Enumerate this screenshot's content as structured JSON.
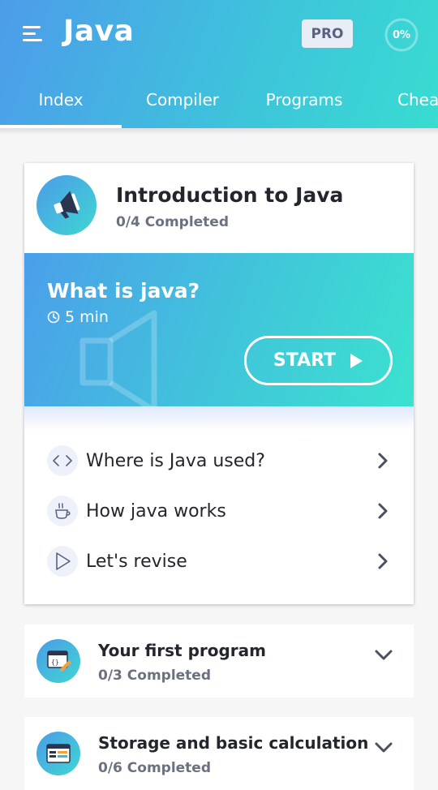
{
  "app": {
    "title": "Java",
    "pro_label": "PRO",
    "progress_label": "0%"
  },
  "tabs": [
    {
      "label": "Index",
      "active": true
    },
    {
      "label": "Compiler"
    },
    {
      "label": "Programs"
    },
    {
      "label": "Cheat Sheet"
    }
  ],
  "chapters": [
    {
      "title": "Introduction to Java",
      "progress": "0/4 Completed",
      "featured_lesson": {
        "title": "What is java?",
        "duration": "5 min",
        "start_label": "START"
      },
      "lessons": [
        {
          "label": "Where is Java used?",
          "icon": "code-brackets-icon"
        },
        {
          "label": "How java works",
          "icon": "coffee-cup-icon"
        },
        {
          "label": "Let's revise",
          "icon": "play-triangle-icon"
        }
      ]
    },
    {
      "title": "Your first program",
      "progress": "0/3 Completed"
    },
    {
      "title": "Storage and basic calculation",
      "progress": "0/6 Completed"
    }
  ],
  "colors": {
    "accent_start": "#4d9cea",
    "accent_end": "#38dcd1",
    "text_dark": "#24262e",
    "text_muted": "#6b7180"
  }
}
